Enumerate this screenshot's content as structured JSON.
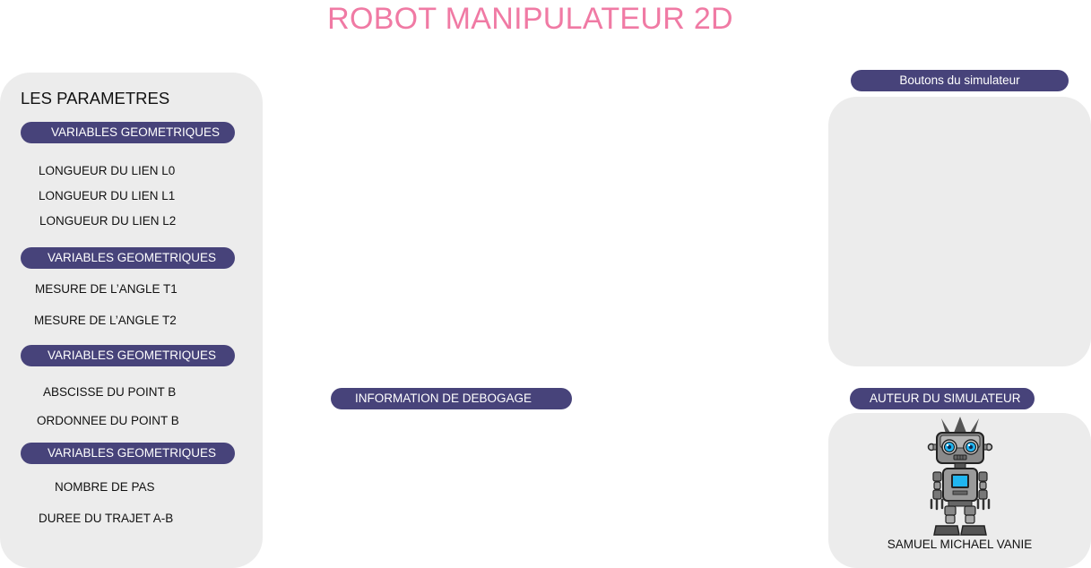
{
  "app": {
    "title": "ROBOT MANIPULATEUR 2D"
  },
  "parameters": {
    "heading": "LES PARAMETRES",
    "groups": [
      {
        "header": "VARIABLES GEOMETRIQUES",
        "items": [
          "LONGUEUR DU LIEN L0",
          "LONGUEUR DU LIEN L1",
          "LONGUEUR DU LIEN L2"
        ]
      },
      {
        "header": "VARIABLES GEOMETRIQUES",
        "items": [
          "MESURE DE L’ANGLE T1",
          "MESURE DE L’ANGLE T2"
        ]
      },
      {
        "header": "VARIABLES GEOMETRIQUES",
        "items": [
          "ABSCISSE DU POINT B",
          "ORDONNEE DU POINT B"
        ]
      },
      {
        "header": "VARIABLES GEOMETRIQUES",
        "items": [
          "NOMBRE DE PAS",
          "DUREE DU TRAJET A-B"
        ]
      }
    ]
  },
  "simulator": {
    "buttons_header": "Boutons du simulateur"
  },
  "debug": {
    "header": "INFORMATION DE DEBOGAGE"
  },
  "author": {
    "header": "AUTEUR DU SIMULATEUR",
    "name": "SAMUEL MICHAEL VANIE",
    "avatar_icon": "robot-icon"
  },
  "colors": {
    "title": "#f07aa4",
    "pill_bg": "#47437a",
    "panel_bg": "#ececec"
  }
}
